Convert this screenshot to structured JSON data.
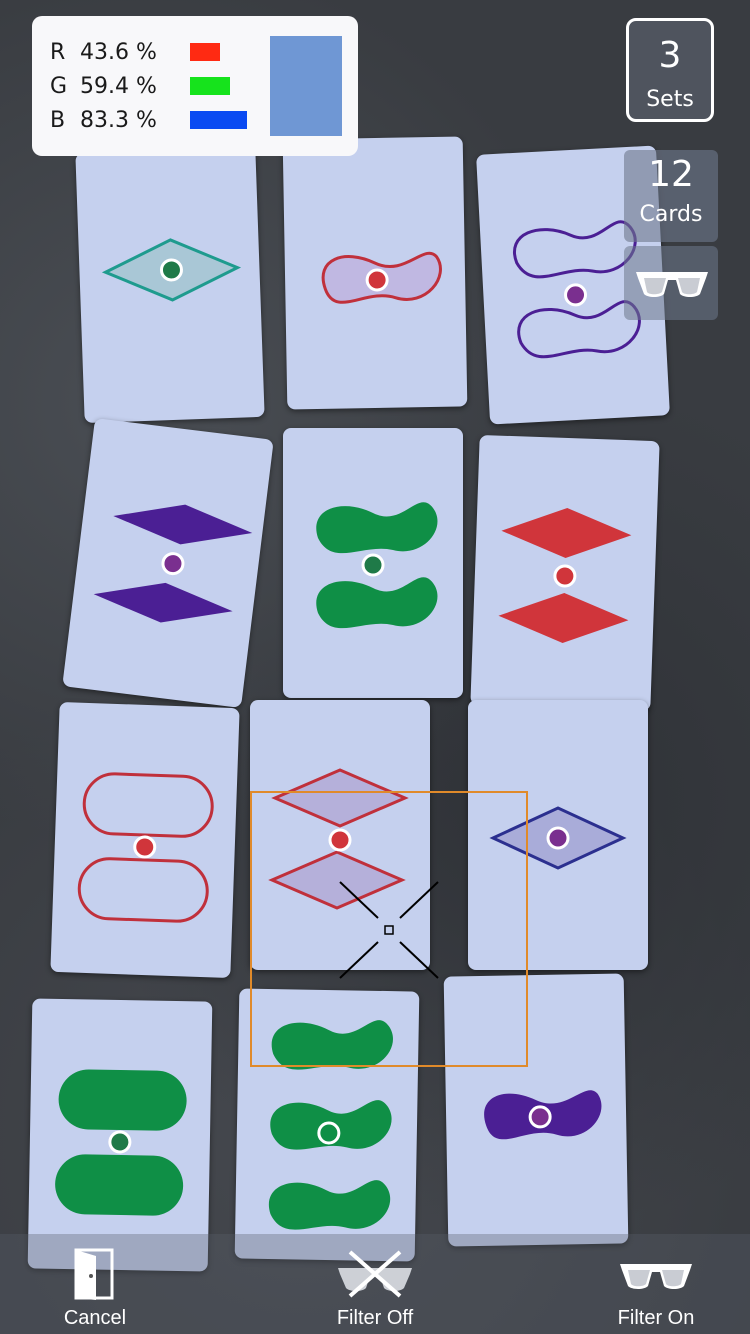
{
  "rgb_readout": {
    "rows": [
      {
        "channel": "R",
        "percent": "43.6 %",
        "value": 0.436,
        "color": "#ff2a12"
      },
      {
        "channel": "G",
        "percent": "59.4 %",
        "value": 0.594,
        "color": "#16e31c"
      },
      {
        "channel": "B",
        "percent": "83.3 %",
        "value": 0.833,
        "color": "#0a4af2"
      }
    ],
    "swatch_color": "#6f97d4"
  },
  "counters": {
    "sets_value": "3",
    "sets_label": "Sets",
    "cards_value": "12",
    "cards_label": "Cards"
  },
  "icons": {
    "glasses": "glasses-icon",
    "door": "door-icon",
    "filter_off": "glasses-crossed-icon",
    "crosshair": "crosshair-icon"
  },
  "toolbar": {
    "cancel_label": "Cancel",
    "filter_off_label": "Filter Off",
    "filter_on_label": "Filter On"
  },
  "colors": {
    "card": "#c5d0ee",
    "red": "#d0353b",
    "green": "#0f8f46",
    "purple": "#4b1f94",
    "teal": "#1e9b8e",
    "focus": "#e08a2a"
  }
}
